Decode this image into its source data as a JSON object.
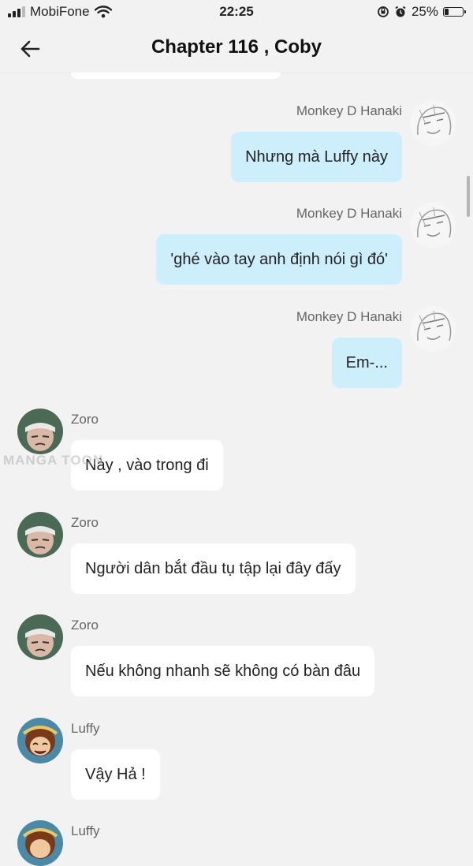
{
  "status_bar": {
    "carrier": "MobiFone",
    "time": "22:25",
    "battery": "25%",
    "battery_level": 0.25
  },
  "header": {
    "title": "Chapter 116 , Coby"
  },
  "messages": [
    {
      "side": "right",
      "sender": "Monkey D Hanaki",
      "text": "Nhưng mà Luffy này"
    },
    {
      "side": "right",
      "sender": "Monkey D Hanaki",
      "text": "'ghé vào tay anh định nói gì đó'"
    },
    {
      "side": "right",
      "sender": "Monkey D Hanaki",
      "text": "Em-..."
    },
    {
      "side": "left",
      "sender": "Zoro",
      "text": "Này , vào trong đi"
    },
    {
      "side": "left",
      "sender": "Zoro",
      "text": "Người dân bắt đầu tụ tập lại đây đấy"
    },
    {
      "side": "left",
      "sender": "Zoro",
      "text": "Nếu không nhanh sẽ không có bàn đâu"
    },
    {
      "side": "left",
      "sender": "Luffy",
      "text": "Vậy Hả !"
    },
    {
      "side": "left",
      "sender": "Luffy"
    }
  ],
  "watermark": "MANGA TOON",
  "colors": {
    "outgoing_bubble": "#cdeefb",
    "incoming_bubble": "#ffffff",
    "background": "#f2f2f2"
  },
  "icons": [
    "signal-icon",
    "wifi-icon",
    "back-arrow-icon",
    "orientation-lock-icon",
    "alarm-icon",
    "battery-icon"
  ]
}
